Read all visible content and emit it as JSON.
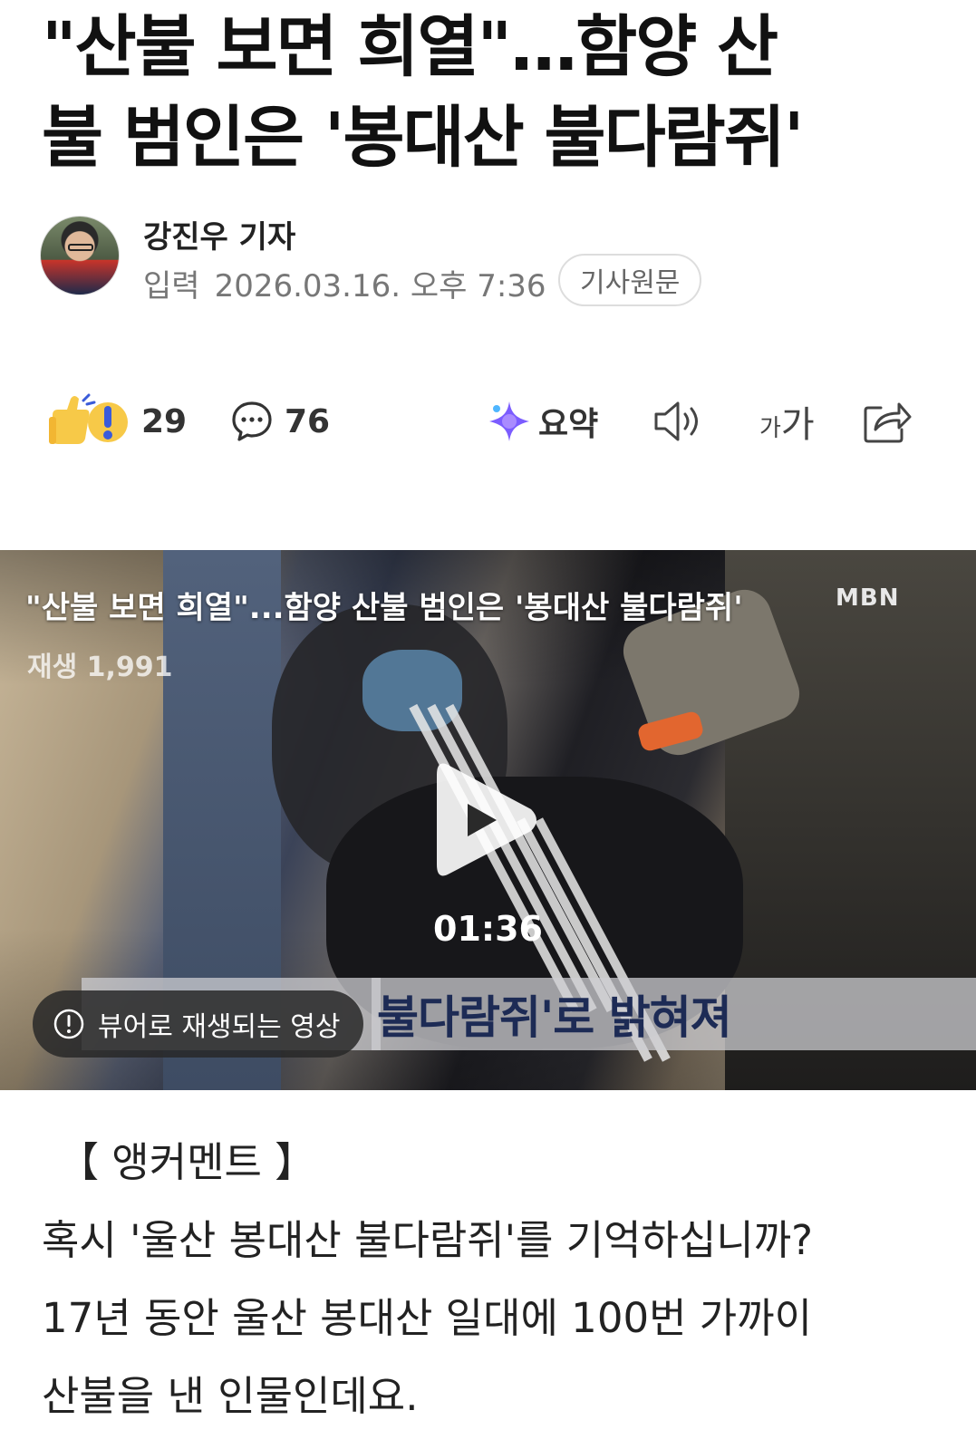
{
  "article": {
    "headline_line1": "\"산불 보면 희열\"…함양 산",
    "headline_line2": "불 범인은 '봉대산 불다람쥐'",
    "author": "강진우 기자",
    "input_label": "입력",
    "datetime": "2026.03.16. 오후 7:36",
    "original_button": "기사원문"
  },
  "actions": {
    "reactions_count": "29",
    "comments_count": "76",
    "summary_label": "요약",
    "font_size_label": "가가"
  },
  "video": {
    "title": "\"산불 보면 희열\"...함양 산불 범인은 '봉대산 불다람쥐'",
    "broadcaster": "MBN",
    "views": "재생 1,991",
    "duration": "01:36",
    "caption": "불다람쥐'로 밝혀져",
    "notice": "뷰어로 재생되는 영상"
  },
  "body": {
    "section": "【 앵커멘트 】",
    "line1": "혹시 '울산 봉대산 불다람쥐'를 기억하십니까?",
    "line2": "17년 동안 울산 봉대산 일대에 100번 가까이",
    "line3": "산불을 낸 인물인데요."
  },
  "colors": {
    "accent_summary": "#7b5cff",
    "reaction_yellow": "#f7c948",
    "text_dark": "#111111",
    "text_muted": "#777777"
  },
  "icons": [
    "reaction-icon",
    "comment-icon",
    "summary-sparkle-icon",
    "speaker-icon",
    "font-size-icon",
    "share-icon",
    "play-icon",
    "info-icon"
  ]
}
